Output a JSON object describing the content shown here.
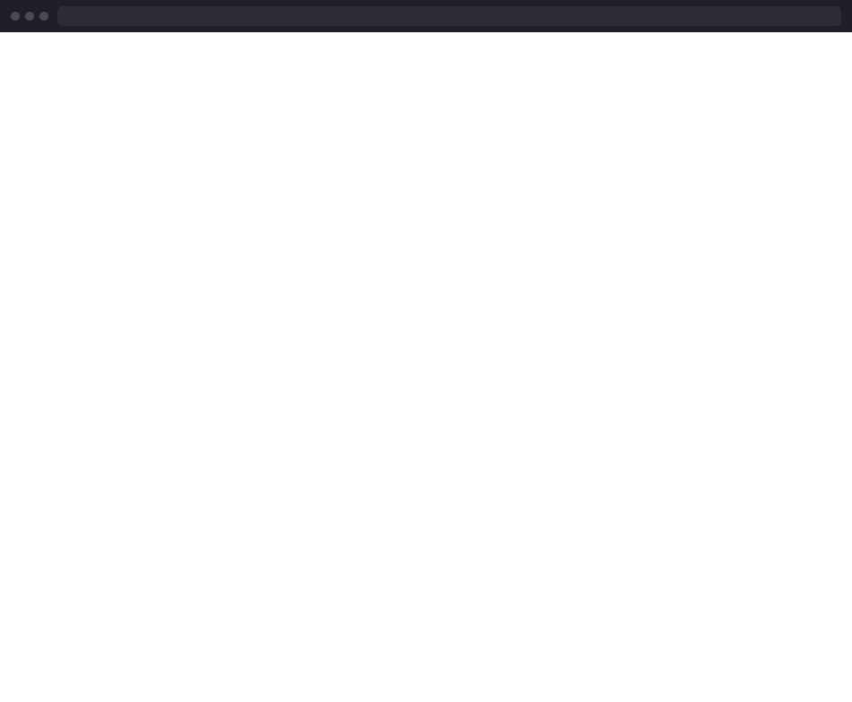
{
  "window": {
    "title": "",
    "content_note": ""
  }
}
